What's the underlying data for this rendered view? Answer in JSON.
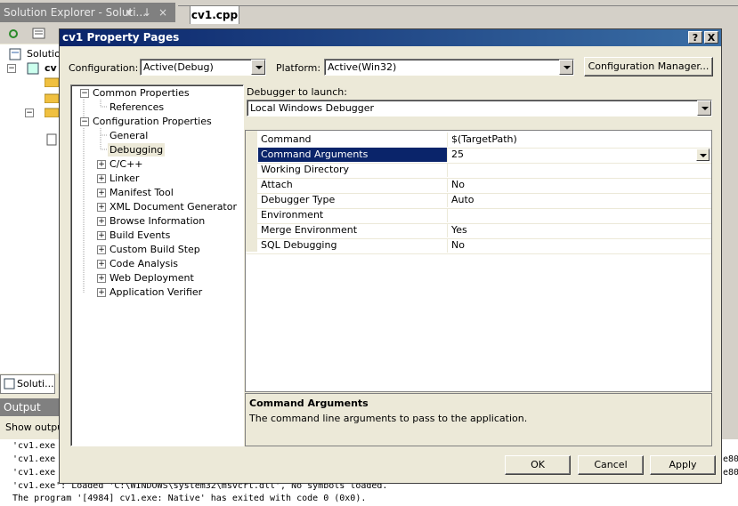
{
  "ide": {
    "solution_explorer_title": "Solution Explorer - Soluti...",
    "pin_glyph": "↓",
    "close_glyph": "×",
    "document_tab": "cv1.cpp",
    "solution_node": "Solutio",
    "project_node": "cv",
    "solution_tab": "Soluti...",
    "output_title": "Output",
    "output_show": "Show output",
    "output_lines": [
      "'cv1.exe",
      "'cv1.exe",
      "'cv1.exe",
      "'cv1.exe': Loaded 'C:\\WINDOWS\\system32\\msvcrt.dll', No symbols loaded.",
      "The program '[4984] cv1.exe: Native' has exited with code 0 (0x0)."
    ],
    "output_right_fragments": [
      "e80",
      "e80"
    ]
  },
  "dialog": {
    "title": "cv1 Property Pages",
    "help_glyph": "?",
    "close_glyph": "X",
    "configuration_label": "Configuration:",
    "configuration_value": "Active(Debug)",
    "platform_label": "Platform:",
    "platform_value": "Active(Win32)",
    "config_manager_button": "Configuration Manager...",
    "debugger_label": "Debugger to launch:",
    "debugger_value": "Local Windows Debugger",
    "tree": {
      "common": "Common Properties",
      "references": "References",
      "config": "Configuration Properties",
      "general": "General",
      "debugging": "Debugging",
      "cpp": "C/C++",
      "linker": "Linker",
      "manifest": "Manifest Tool",
      "xmldoc": "XML Document Generator",
      "browse": "Browse Information",
      "build_events": "Build Events",
      "custom_build": "Custom Build Step",
      "code_analysis": "Code Analysis",
      "web_deploy": "Web Deployment",
      "app_verifier": "Application Verifier"
    },
    "properties": [
      {
        "name": "Command",
        "value": "$(TargetPath)"
      },
      {
        "name": "Command Arguments",
        "value": "25"
      },
      {
        "name": "Working Directory",
        "value": ""
      },
      {
        "name": "Attach",
        "value": "No"
      },
      {
        "name": "Debugger Type",
        "value": "Auto"
      },
      {
        "name": "Environment",
        "value": ""
      },
      {
        "name": "Merge Environment",
        "value": "Yes"
      },
      {
        "name": "SQL Debugging",
        "value": "No"
      }
    ],
    "description_title": "Command Arguments",
    "description_text": "The command line arguments to pass to the application.",
    "ok_button": "OK",
    "cancel_button": "Cancel",
    "apply_button": "Apply"
  }
}
